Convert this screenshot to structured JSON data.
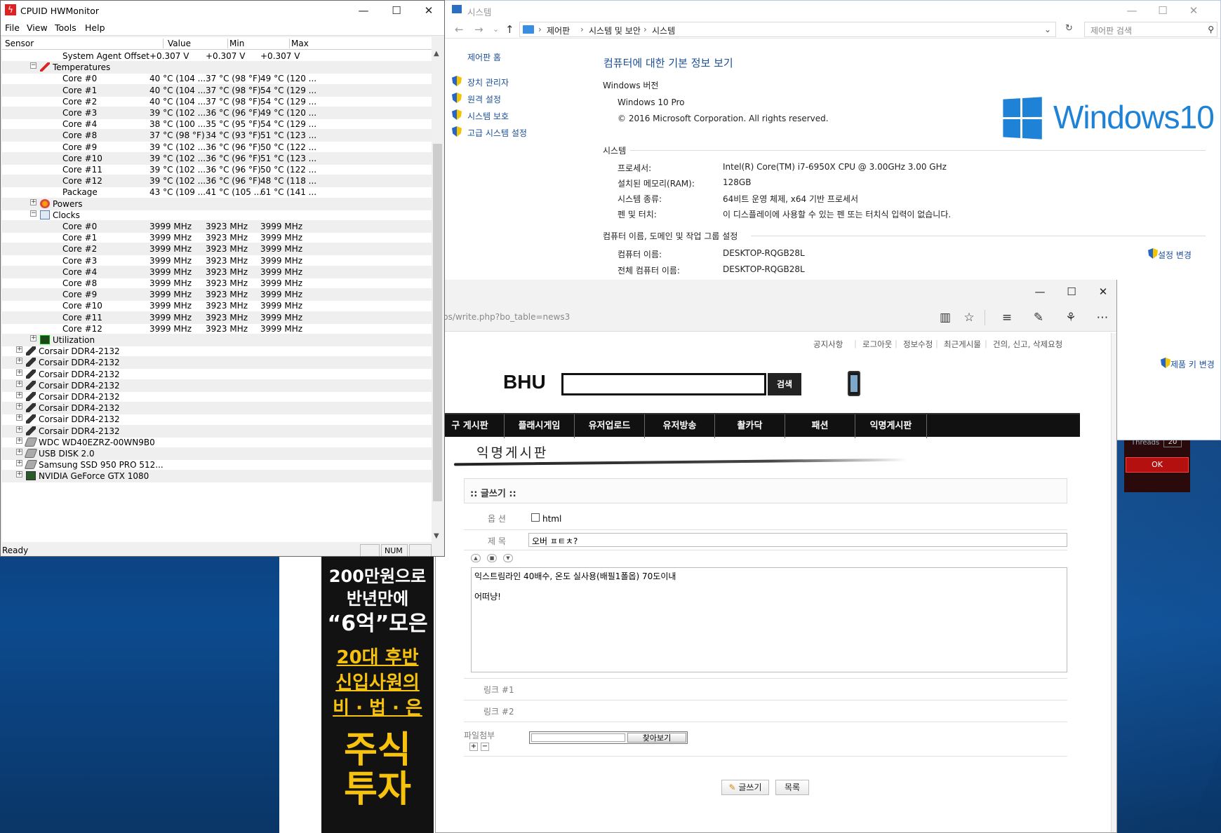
{
  "hwmonitor": {
    "title": "CPUID HWMonitor",
    "menu": [
      "File",
      "View",
      "Tools",
      "Help"
    ],
    "columns": [
      "Sensor",
      "Value",
      "Min",
      "Max"
    ],
    "rows": [
      {
        "indent": 3,
        "label": "System Agent Offset",
        "value": "+0.307 V",
        "min": "+0.307 V",
        "max": "+0.307 V"
      },
      {
        "indent": 2,
        "label": "Temperatures",
        "expand": "−",
        "icon": "thermometer-icon"
      },
      {
        "indent": 3,
        "label": "Core #0",
        "value": "40 °C  (104 ...",
        "min": "37 °C  (98 °F)",
        "max": "49 °C  (120 ..."
      },
      {
        "indent": 3,
        "label": "Core #1",
        "value": "40 °C  (104 ...",
        "min": "37 °C  (98 °F)",
        "max": "54 °C  (129 ..."
      },
      {
        "indent": 3,
        "label": "Core #2",
        "value": "40 °C  (104 ...",
        "min": "37 °C  (98 °F)",
        "max": "54 °C  (129 ..."
      },
      {
        "indent": 3,
        "label": "Core #3",
        "value": "39 °C  (102 ...",
        "min": "36 °C  (96 °F)",
        "max": "49 °C  (120 ..."
      },
      {
        "indent": 3,
        "label": "Core #4",
        "value": "38 °C  (100 ...",
        "min": "35 °C  (95 °F)",
        "max": "54 °C  (129 ..."
      },
      {
        "indent": 3,
        "label": "Core #8",
        "value": "37 °C  (98 °F)",
        "min": "34 °C  (93 °F)",
        "max": "51 °C  (123 ..."
      },
      {
        "indent": 3,
        "label": "Core #9",
        "value": "39 °C  (102 ...",
        "min": "36 °C  (96 °F)",
        "max": "50 °C  (122 ..."
      },
      {
        "indent": 3,
        "label": "Core #10",
        "value": "39 °C  (102 ...",
        "min": "36 °C  (96 °F)",
        "max": "51 °C  (123 ..."
      },
      {
        "indent": 3,
        "label": "Core #11",
        "value": "39 °C  (102 ...",
        "min": "36 °C  (96 °F)",
        "max": "50 °C  (122 ..."
      },
      {
        "indent": 3,
        "label": "Core #12",
        "value": "39 °C  (102 ...",
        "min": "36 °C  (96 °F)",
        "max": "48 °C  (118 ..."
      },
      {
        "indent": 3,
        "label": "Package",
        "value": "43 °C  (109 ...",
        "min": "41 °C  (105 ...",
        "max": "61 °C  (141 ..."
      },
      {
        "indent": 2,
        "label": "Powers",
        "expand": "+",
        "icon": "power-icon"
      },
      {
        "indent": 2,
        "label": "Clocks",
        "expand": "−",
        "icon": "clock-icon"
      },
      {
        "indent": 3,
        "label": "Core #0",
        "value": "3999 MHz",
        "min": "3923 MHz",
        "max": "3999 MHz"
      },
      {
        "indent": 3,
        "label": "Core #1",
        "value": "3999 MHz",
        "min": "3923 MHz",
        "max": "3999 MHz"
      },
      {
        "indent": 3,
        "label": "Core #2",
        "value": "3999 MHz",
        "min": "3923 MHz",
        "max": "3999 MHz"
      },
      {
        "indent": 3,
        "label": "Core #3",
        "value": "3999 MHz",
        "min": "3923 MHz",
        "max": "3999 MHz"
      },
      {
        "indent": 3,
        "label": "Core #4",
        "value": "3999 MHz",
        "min": "3923 MHz",
        "max": "3999 MHz"
      },
      {
        "indent": 3,
        "label": "Core #8",
        "value": "3999 MHz",
        "min": "3923 MHz",
        "max": "3999 MHz"
      },
      {
        "indent": 3,
        "label": "Core #9",
        "value": "3999 MHz",
        "min": "3923 MHz",
        "max": "3999 MHz"
      },
      {
        "indent": 3,
        "label": "Core #10",
        "value": "3999 MHz",
        "min": "3923 MHz",
        "max": "3999 MHz"
      },
      {
        "indent": 3,
        "label": "Core #11",
        "value": "3999 MHz",
        "min": "3923 MHz",
        "max": "3999 MHz"
      },
      {
        "indent": 3,
        "label": "Core #12",
        "value": "3999 MHz",
        "min": "3923 MHz",
        "max": "3999 MHz"
      },
      {
        "indent": 2,
        "label": "Utilization",
        "expand": "+",
        "icon": "utilization-icon"
      },
      {
        "indent": 1,
        "label": "Corsair DDR4-2132",
        "expand": "+",
        "icon": "ram-icon"
      },
      {
        "indent": 1,
        "label": "Corsair DDR4-2132",
        "expand": "+",
        "icon": "ram-icon"
      },
      {
        "indent": 1,
        "label": "Corsair DDR4-2132",
        "expand": "+",
        "icon": "ram-icon"
      },
      {
        "indent": 1,
        "label": "Corsair DDR4-2132",
        "expand": "+",
        "icon": "ram-icon"
      },
      {
        "indent": 1,
        "label": "Corsair DDR4-2132",
        "expand": "+",
        "icon": "ram-icon"
      },
      {
        "indent": 1,
        "label": "Corsair DDR4-2132",
        "expand": "+",
        "icon": "ram-icon"
      },
      {
        "indent": 1,
        "label": "Corsair DDR4-2132",
        "expand": "+",
        "icon": "ram-icon"
      },
      {
        "indent": 1,
        "label": "Corsair DDR4-2132",
        "expand": "+",
        "icon": "ram-icon"
      },
      {
        "indent": 1,
        "label": "WDC WD40EZRZ-00WN9B0",
        "expand": "+",
        "icon": "hdd-icon"
      },
      {
        "indent": 1,
        "label": "USB DISK 2.0",
        "expand": "+",
        "icon": "hdd-icon"
      },
      {
        "indent": 1,
        "label": "Samsung SSD 950 PRO 512...",
        "expand": "+",
        "icon": "hdd-icon"
      },
      {
        "indent": 1,
        "label": "NVIDIA GeForce GTX 1080",
        "expand": "+",
        "icon": "gpu-icon"
      }
    ],
    "status": "Ready",
    "num": "NUM"
  },
  "system": {
    "title": "시스템",
    "breadcrumb": [
      "제어판",
      "시스템 및 보안",
      "시스템"
    ],
    "search_placeholder": "제어판 검색",
    "sidebar_home": "제어판 홈",
    "sidebar": [
      "장치 관리자",
      "원격 설정",
      "시스템 보호",
      "고급 시스템 설정"
    ],
    "heading": "컴퓨터에 대한 기본 정보 보기",
    "win_version_header": "Windows 버전",
    "edition": "Windows 10 Pro",
    "copyright": "© 2016 Microsoft Corporation. All rights reserved.",
    "logo_text": "Windows10",
    "system_header": "시스템",
    "specs": [
      {
        "k": "프로세서:",
        "v": "Intel(R) Core(TM) i7-6950X CPU @ 3.00GHz   3.00 GHz"
      },
      {
        "k": "설치된 메모리(RAM):",
        "v": "128GB"
      },
      {
        "k": "시스템 종류:",
        "v": "64비트 운영 체제, x64 기반 프로세서"
      },
      {
        "k": "펜 및 터치:",
        "v": "이 디스플레이에 사용할 수 있는 펜 또는 터치식 입력이 없습니다."
      }
    ],
    "name_header": "컴퓨터 이름, 도메인 및 작업 그룹 설정",
    "names": [
      {
        "k": "컴퓨터 이름:",
        "v": "DESKTOP-RQGB28L"
      },
      {
        "k": "전체 컴퓨터 이름:",
        "v": "DESKTOP-RQGB28L"
      }
    ],
    "change_settings": "설정 변경",
    "product_key": "제품 키 변경"
  },
  "browser": {
    "url": "bs/write.php?bo_table=news3",
    "top_links": [
      "공지사항",
      "로그아웃",
      "정보수정",
      "최근게시물",
      "건의, 신고, 삭제요청"
    ],
    "site_logo": "BHU",
    "search_button": "검색",
    "nav": [
      "구 게시판",
      "플래시게임",
      "유저업로드",
      "유저방송",
      "촬카닥",
      "패션",
      "익명게시판"
    ],
    "board_title": "익명게시판",
    "write_header": ":: 글쓰기 ::",
    "option_label": "옵 션",
    "html_label": "html",
    "subject_label": "제 목",
    "subject_value": "오버 ㅍㅌㅊ?",
    "content_line1": "익스트림라인 40배수, 온도 실사용(배필1폴옵) 70도이내",
    "content_line2": "어떠냥!",
    "link1_label": "링크 #1",
    "link2_label": "링크 #2",
    "file_label": "파일첨부",
    "browse_button": "찾아보기",
    "write_button": "글쓰기",
    "list_button": "목록"
  },
  "ad": {
    "line1": "200만원으로",
    "line2": "반년만에",
    "line3": "“6억”모은",
    "line4": "20대 후반",
    "line5": "신입사원의",
    "line6": "비 · 법 · 은",
    "line7": "주식",
    "line8": "투자"
  },
  "bg_app": {
    "threads_label": "Threads",
    "threads_value": "20",
    "ok_button": "OK"
  }
}
